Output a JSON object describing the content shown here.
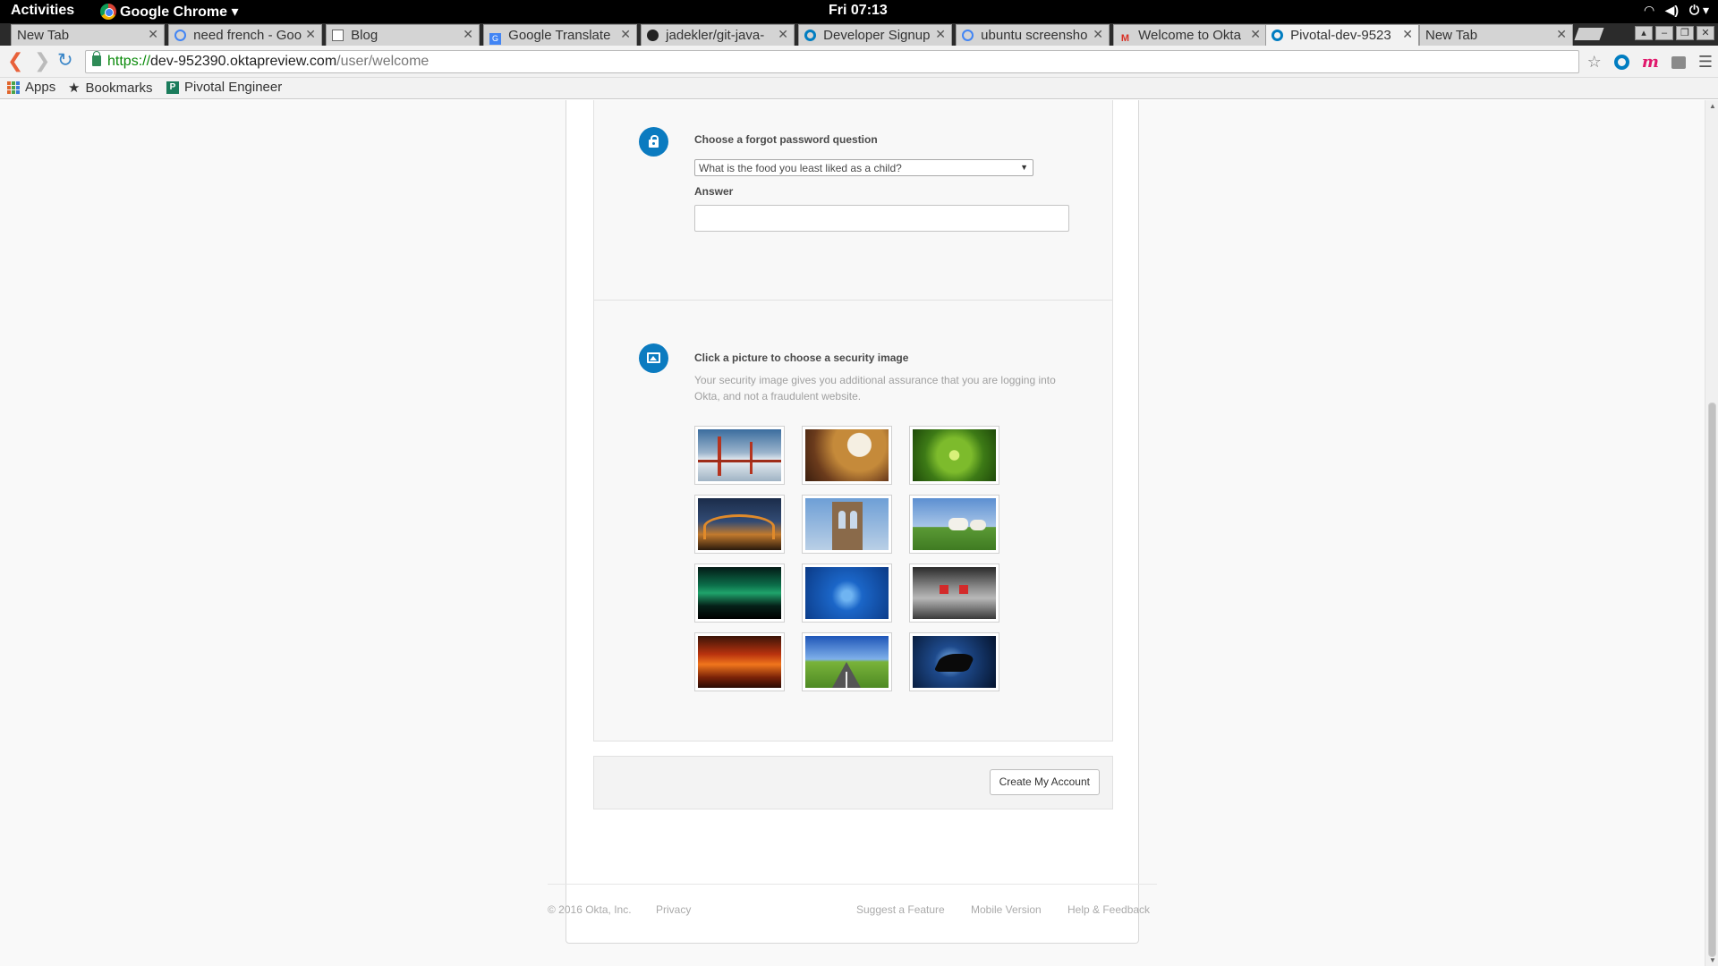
{
  "topbar": {
    "activities": "Activities",
    "app_menu": "Google Chrome ▾",
    "clock": "Fri 07:13"
  },
  "tabs": [
    {
      "label": "New Tab",
      "favicon": "none",
      "active": false
    },
    {
      "label": "need french - Goo",
      "favicon": "google-icon",
      "active": false
    },
    {
      "label": "Blog",
      "favicon": "document-icon",
      "active": false
    },
    {
      "label": "Google Translate",
      "favicon": "google-translate-icon",
      "active": false
    },
    {
      "label": "jadekler/git-java-",
      "favicon": "github-icon",
      "active": false
    },
    {
      "label": "Developer Signup",
      "favicon": "okta-icon",
      "active": false
    },
    {
      "label": "ubuntu screensho",
      "favicon": "google-icon",
      "active": false
    },
    {
      "label": "Welcome to Okta",
      "favicon": "gmail-icon",
      "active": false
    },
    {
      "label": "Pivotal-dev-9523",
      "favicon": "okta-icon",
      "active": true
    },
    {
      "label": "New Tab",
      "favicon": "none",
      "active": false
    }
  ],
  "omnibox": {
    "scheme": "https://",
    "host": "dev-952390.oktapreview.com",
    "path": "/user/welcome"
  },
  "bookmarks": {
    "apps": "Apps",
    "bookmarks": "Bookmarks",
    "pivotal": "Pivotal Engineer"
  },
  "question_section": {
    "question_label": "Choose a forgot password question",
    "selected_question": "What is the food you least liked as a child?",
    "answer_label": "Answer",
    "answer_value": ""
  },
  "image_section": {
    "title": "Click a picture to choose a security image",
    "description": "Your security image gives you additional assurance that you are logging into Okta, and not a fraudulent website.",
    "images": [
      {
        "name": "golden-gate-bridge-image"
      },
      {
        "name": "beer-glass-image"
      },
      {
        "name": "succulent-plant-image"
      },
      {
        "name": "harbour-bridge-night-image"
      },
      {
        "name": "brooklyn-bridge-image"
      },
      {
        "name": "sheep-field-image"
      },
      {
        "name": "aurora-image"
      },
      {
        "name": "circuit-board-image"
      },
      {
        "name": "robot-image"
      },
      {
        "name": "sunset-clouds-image"
      },
      {
        "name": "open-road-image"
      },
      {
        "name": "manta-ray-image"
      }
    ]
  },
  "actions": {
    "create_account": "Create My Account"
  },
  "footer": {
    "copyright": "© 2016 Okta, Inc.",
    "privacy": "Privacy",
    "suggest": "Suggest a Feature",
    "mobile": "Mobile Version",
    "help": "Help & Feedback"
  },
  "colors": {
    "accent": "#0b7bc0",
    "page_bg": "#f9f9f9"
  }
}
